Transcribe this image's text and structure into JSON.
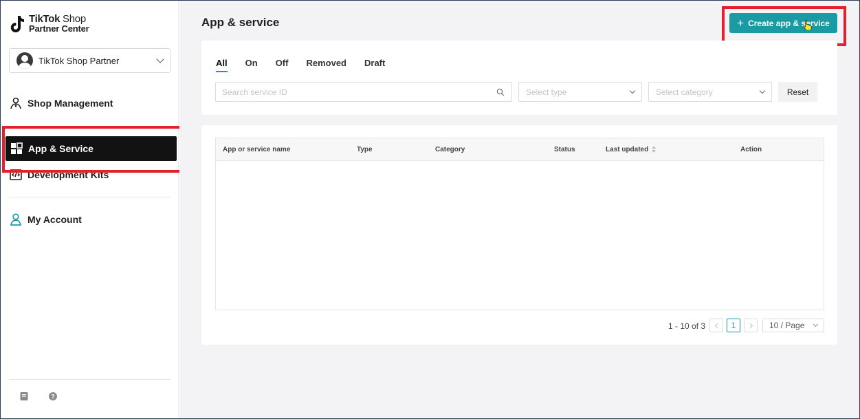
{
  "brand": {
    "logo_line1_bold": "TikTok",
    "logo_line1_light": " Shop",
    "logo_line2": "Partner Center"
  },
  "account": {
    "name": "TikTok Shop Partner"
  },
  "sidebar": {
    "items": [
      {
        "label": "Shop Management",
        "icon": "user-icon"
      },
      {
        "label": "App & Service",
        "icon": "grid-icon",
        "active": true
      },
      {
        "label": "Development Kits",
        "icon": "code-icon"
      },
      {
        "label": "My Account",
        "icon": "account-icon"
      }
    ],
    "footer_icons": [
      "document-icon",
      "help-icon"
    ]
  },
  "header": {
    "title": "App & service",
    "create_button": "Create app & service"
  },
  "filters": {
    "tabs": [
      "All",
      "On",
      "Off",
      "Removed",
      "Draft"
    ],
    "active_tab": "All",
    "search_placeholder": "Search service ID",
    "type_placeholder": "Select type",
    "category_placeholder": "Select category",
    "reset_label": "Reset"
  },
  "table": {
    "columns": [
      "App or service name",
      "Type",
      "Category",
      "Status",
      "Last updated",
      "Action"
    ],
    "rows": []
  },
  "pagination": {
    "summary": "1 - 10 of 3",
    "current_page": "1",
    "page_size": "10 / Page"
  },
  "colors": {
    "accent": "#1a9ba3",
    "highlight": "#e5202d",
    "active_nav": "#121212"
  }
}
